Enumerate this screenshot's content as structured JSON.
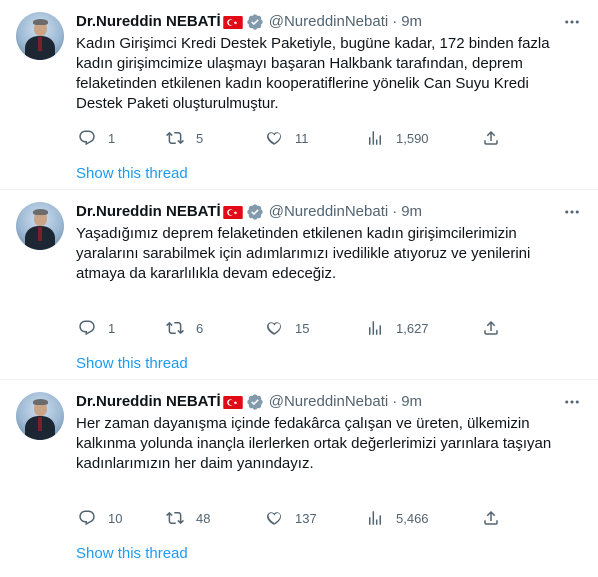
{
  "colors": {
    "link": "#1d9bf0",
    "secondary_text": "#536471",
    "verified_badge": "#829aab",
    "flag_red": "#e30a17",
    "divider": "#eff3f4"
  },
  "icons": {
    "verified": "verified-badge-icon",
    "flag": "turkey-flag-icon",
    "more": "more-horizontal-icon",
    "reply": "reply-icon",
    "retweet": "retweet-icon",
    "like": "like-icon",
    "views": "views-icon",
    "share": "share-icon"
  },
  "tweets": [
    {
      "author_name": "Dr.Nureddin NEBATİ",
      "handle": "@NureddinNebati",
      "separator": "·",
      "time": "9m",
      "text": "Kadın Girişimci Kredi Destek Paketiyle, bugüne kadar, 172 binden fazla kadın girişimcimize ulaşmayı başaran Halkbank tarafından, deprem felaketinden etkilenen kadın kooperatiflerine yönelik Can Suyu Kredi Destek Paketi oluşturulmuştur.",
      "replies": "1",
      "retweets": "5",
      "likes": "11",
      "views": "1,590",
      "show_thread": "Show this thread"
    },
    {
      "author_name": "Dr.Nureddin NEBATİ",
      "handle": "@NureddinNebati",
      "separator": "·",
      "time": "9m",
      "text": "Yaşadığımız deprem felaketinden etkilenen kadın girişimcilerimizin yaralarını sarabilmek için adımlarımızı ivedilikle atıyoruz ve yenilerini atmaya da kararlılıkla devam edeceğiz.",
      "replies": "1",
      "retweets": "6",
      "likes": "15",
      "views": "1,627",
      "show_thread": "Show this thread"
    },
    {
      "author_name": "Dr.Nureddin NEBATİ",
      "handle": "@NureddinNebati",
      "separator": "·",
      "time": "9m",
      "text": "Her zaman dayanışma içinde fedakârca çalışan ve üreten, ülkemizin kalkınma yolunda inançla ilerlerken ortak değerlerimizi yarınlara taşıyan kadınlarımızın her daim yanındayız.",
      "replies": "10",
      "retweets": "48",
      "likes": "137",
      "views": "5,466",
      "show_thread": "Show this thread"
    }
  ]
}
